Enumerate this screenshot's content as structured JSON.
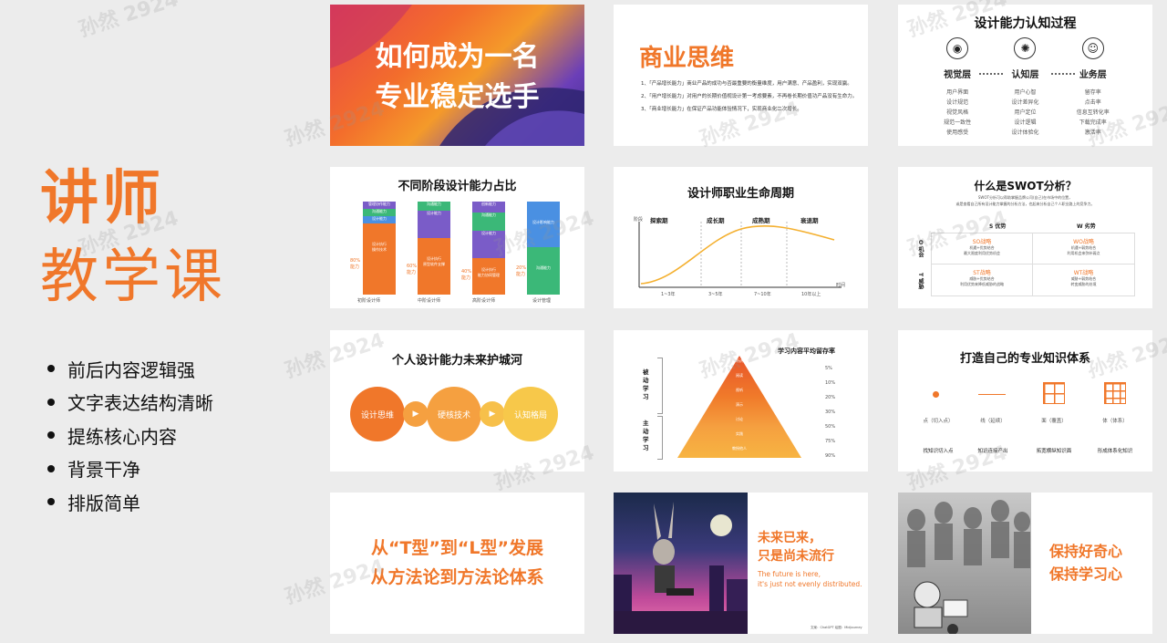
{
  "intro": {
    "title_line1": "讲师",
    "title_line2": "教学课",
    "bullets": [
      "前后内容逻辑强",
      "文字表达结构清晰",
      "提练核心内容",
      "背景干净",
      "排版简单"
    ]
  },
  "watermark": "孙然 2924",
  "slide1": {
    "line1": "如何成为一名",
    "line2": "专业稳定选手"
  },
  "slide2": {
    "title": "商业思维",
    "items": [
      "1、「产品增长能力」商业产品的成功与否最重要的衡量维度，用户满意、产品盈利，实现双赢。",
      "2、「用户增长能力」对用户的长期价值视设计第一考虑要素，不再卷长期价值功产品没有生命力。",
      "3、「商业增长能力」在保证产品功能体验情况下，实现商业化二次增长。"
    ]
  },
  "slide3": {
    "title": "设计能力认知过程",
    "cols": [
      {
        "label": "视觉层",
        "items": [
          "用户界面",
          "设计规范",
          "视觉风格",
          "规范一致性",
          "使用感受"
        ]
      },
      {
        "label": "认知层",
        "items": [
          "用户心智",
          "设计差异化",
          "用户定位",
          "设计逻辑",
          "设计体验化"
        ]
      },
      {
        "label": "业务层",
        "items": [
          "留存率",
          "点击率",
          "信息互转化率",
          "下载完成率",
          "激活率"
        ]
      }
    ]
  },
  "slide4": {
    "title": "不同阶段设计能力占比",
    "bars": [
      {
        "label": "初阶设计师",
        "pct": "80%\n能力",
        "segments": [
          "管理协作能力",
          "沟通能力",
          "设计能力",
          "设计执行\n操作技术"
        ]
      },
      {
        "label": "中阶设计师",
        "pct": "60%\n能力",
        "segments": [
          "沟通能力",
          "设计能力",
          "设计执行\n原型软件支撑"
        ]
      },
      {
        "label": "高阶设计师",
        "pct": "40%\n能力",
        "segments": [
          "创新能力",
          "沟通能力",
          "设计能力",
          "设计执行\n能力协同管理"
        ]
      },
      {
        "label": "设计管理",
        "pct": "20%\n能力",
        "segments": [
          "设计影响能力",
          "沟通能力"
        ]
      }
    ]
  },
  "slide5": {
    "title": "设计师职业生命周期",
    "yaxis": "阶段",
    "xaxis": "时间",
    "phases": [
      "探索期",
      "成长期",
      "成熟期",
      "衰退期"
    ],
    "periods": [
      "1~3年",
      "3~5年",
      "7~10年",
      "10年以上"
    ]
  },
  "slide6": {
    "title": "什么是SWOT分析？",
    "desc1": "SWOT分析可以帮助掌握品牌公司(自己)在市场中的位置，",
    "desc2": "或是查看自己所有设计能力掌握的分析方法，也起来分析自己个人职业路上的竞争力。",
    "s": "S 优势",
    "w": "W 劣势",
    "o": "O 机会",
    "t": "T 威胁",
    "cells": [
      {
        "name": "SO战略",
        "text": "机遇+优势结合\n最大限度利用优势机会"
      },
      {
        "name": "WO战略",
        "text": "机遇+弱势结合\n利用机会来弥补弱点"
      },
      {
        "name": "ST战略",
        "text": "威胁+优势结合\n利用优势来降低威胁的战略"
      },
      {
        "name": "WT战略",
        "text": "威胁+弱势结合\n转变威胁的处境"
      }
    ]
  },
  "slide7": {
    "title": "个人设计能力未来护城河",
    "circles": [
      "设计思维",
      "硬核技术",
      "认知格局"
    ]
  },
  "slide8": {
    "title": "学习内容平均留存率",
    "passive": "被动学习",
    "active": "主动学习",
    "levels": [
      {
        "label": "听讲",
        "pct": "5%"
      },
      {
        "label": "阅读",
        "pct": "10%"
      },
      {
        "label": "视听",
        "pct": "20%"
      },
      {
        "label": "演示",
        "pct": "30%"
      },
      {
        "label": "讨论",
        "pct": "50%"
      },
      {
        "label": "实践",
        "pct": "75%"
      },
      {
        "label": "教授他人",
        "pct": "90%"
      }
    ]
  },
  "slide9": {
    "title": "打造自己的专业知识体系",
    "cols": [
      {
        "name": "点（切入点）",
        "desc": "找知识切入点"
      },
      {
        "name": "线（延续）",
        "desc": "知识连接产出"
      },
      {
        "name": "面（覆盖）",
        "desc": "拓宽横纵知识面"
      },
      {
        "name": "体（体系）",
        "desc": "形成体系化知识"
      }
    ]
  },
  "slide10": {
    "line1": "从“T型”到“L型”发展",
    "line2": "从方法论到方法论体系"
  },
  "slide11": {
    "line1": "未来已来，",
    "line2": "只是尚未流行",
    "en1": "The future is here,",
    "en2": "it's just not evenly distributed.",
    "credit": "文案：ChatGPT  绘图：Midjourney"
  },
  "slide12": {
    "line1": "保持好奇心",
    "line2": "保持学习心"
  }
}
